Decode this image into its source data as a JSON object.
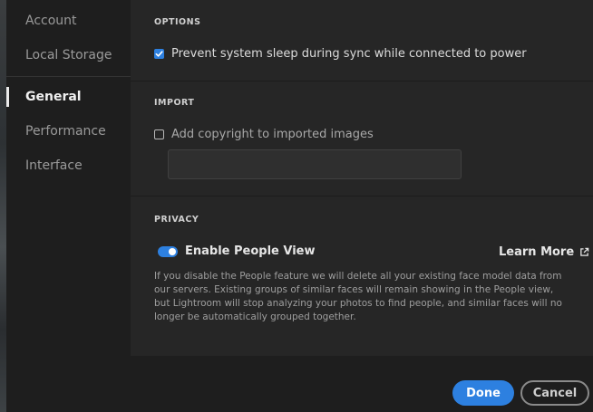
{
  "sidebar": {
    "items": [
      {
        "label": "Account",
        "active": false
      },
      {
        "label": "Local Storage",
        "active": false
      },
      {
        "label": "General",
        "active": true
      },
      {
        "label": "Performance",
        "active": false
      },
      {
        "label": "Interface",
        "active": false
      }
    ]
  },
  "options": {
    "title": "OPTIONS",
    "prevent_sleep": {
      "label": "Prevent system sleep during sync while connected to power",
      "checked": true
    }
  },
  "import": {
    "title": "IMPORT",
    "add_copyright": {
      "label": "Add copyright to imported images",
      "checked": false
    },
    "copyright_value": ""
  },
  "privacy": {
    "title": "PRIVACY",
    "people_view": {
      "label": "Enable People View",
      "enabled": true
    },
    "learn_more": "Learn More",
    "description": "If you disable the People feature we will delete all your existing face model data from our servers. Existing groups of similar faces will remain showing in the People view, but Lightroom will stop analyzing your photos to find people, and similar faces will no longer be automatically grouped together."
  },
  "footer": {
    "done_label": "Done",
    "cancel_label": "Cancel"
  },
  "colors": {
    "accent": "#2d80e0",
    "background": "#1e1e1e",
    "panel": "#262626"
  },
  "icons": [
    "checkmark-icon",
    "external-link-icon"
  ]
}
